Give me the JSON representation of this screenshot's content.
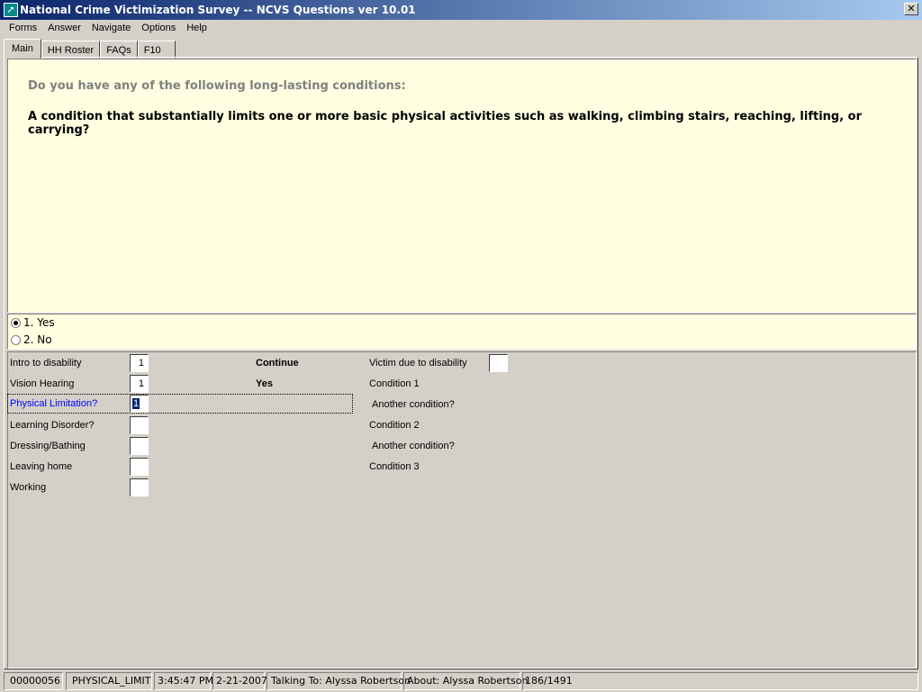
{
  "window": {
    "title": "National Crime Victimization Survey -- NCVS Questions ver 10.01",
    "close": "✕"
  },
  "menu": [
    "Forms",
    "Answer",
    "Navigate",
    "Options",
    "Help"
  ],
  "tabs": [
    "Main",
    "HH Roster",
    "FAQs",
    "F10"
  ],
  "question": {
    "intro": "Do you have any of the following long-lasting conditions:",
    "text": "A condition that substantially limits one or more basic physical activities such as walking, climbing stairs, reaching, lifting, or carrying?"
  },
  "answers": [
    {
      "label": "1.  Yes",
      "selected": true
    },
    {
      "label": "2.  No",
      "selected": false
    }
  ],
  "form": {
    "rows": [
      {
        "label": "Intro to disability",
        "value": "1",
        "note": "Continue"
      },
      {
        "label": "Vision Hearing",
        "value": "1",
        "note": "Yes"
      },
      {
        "label": "Physical Limitation?",
        "value": "1",
        "note": ""
      },
      {
        "label": "Learning Disorder?",
        "value": "",
        "note": ""
      },
      {
        "label": "Dressing/Bathing",
        "value": "",
        "note": ""
      },
      {
        "label": "Leaving home",
        "value": "",
        "note": ""
      },
      {
        "label": "Working",
        "value": "",
        "note": ""
      }
    ],
    "right": [
      "Victim due to disability",
      "Condition 1",
      " Another condition?",
      "Condition 2",
      " Another condition?",
      "Condition 3"
    ],
    "right_value": ""
  },
  "status": [
    "00000056",
    "PHYSICAL_LIMIT",
    "3:45:47 PM",
    "2-21-2007",
    "Talking To: Alyssa Robertson",
    "About:  Alyssa Robertson",
    "186/1491"
  ]
}
